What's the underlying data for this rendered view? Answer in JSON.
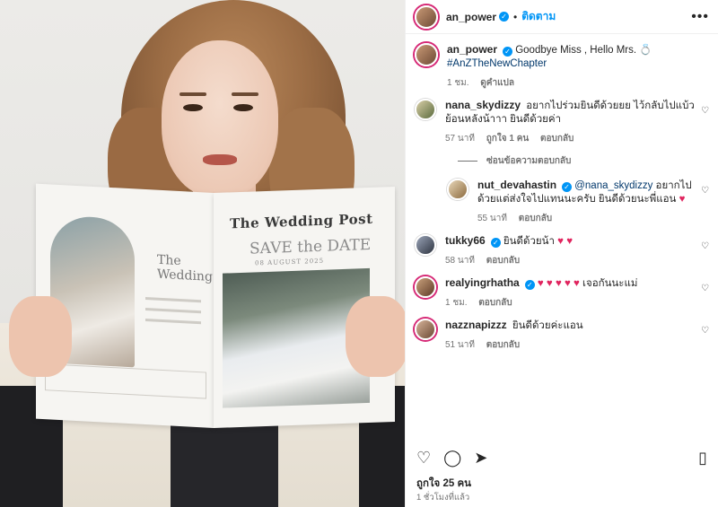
{
  "photo": {
    "paper_title": "The Wedding Post",
    "paper_headline": "SAVE the DATE",
    "paper_subline": "08 AUGUST 2025",
    "paper_left_word": "The Wedding"
  },
  "header": {
    "username": "an_power",
    "follow_label": "ติดตาม",
    "more_label": "•••"
  },
  "caption": {
    "username": "an_power",
    "text": "Goodbye Miss , Hello Mrs. 💍",
    "hashtag": "#AnZTheNewChapter",
    "time": "1 ชม.",
    "translate": "ดูคำแปล"
  },
  "comments": [
    {
      "username": "nana_skydizzy",
      "text": "อยากไปร่วมยินดีด้วยยย ไว้กลับไปแบ้วย้อนหลังน้าาา ยินดีด้วยค่า",
      "time": "57 นาที",
      "likes": "ถูกใจ 1 คน",
      "reply": "ตอบกลับ"
    }
  ],
  "reply_toggle": "ซ่อนข้อความตอบกลับ",
  "nested": {
    "username": "nut_devahastin",
    "mention": "@nana_skydizzy",
    "text": "อยากไปด้วยแต่ส่งใจไปแทนนะครับ ยินดีด้วยนะพี่แอน",
    "time": "55 นาที",
    "reply": "ตอบกลับ"
  },
  "comments2": [
    {
      "username": "tukky66",
      "text": "ยินดีด้วยน้า",
      "time": "58 นาที",
      "reply": "ตอบกลับ"
    },
    {
      "username": "realyingrhatha",
      "text": "เจอกันนะแม่",
      "time": "1 ชม.",
      "reply": "ตอบกลับ"
    },
    {
      "username": "nazznapizzz",
      "text": "ยินดีด้วยค่ะแอน",
      "time": "51 นาที",
      "reply": "ตอบกลับ"
    }
  ],
  "likes_text": "ถูกใจ 25 คน",
  "posted_time": "1 ชั่วโมงที่แล้ว",
  "colors": {
    "link": "#0095f6",
    "heart": "#e0245e",
    "muted": "#737373"
  },
  "icons": [
    "heart-icon",
    "comment-icon",
    "share-icon",
    "bookmark-icon",
    "verified-icon",
    "more-icon"
  ]
}
